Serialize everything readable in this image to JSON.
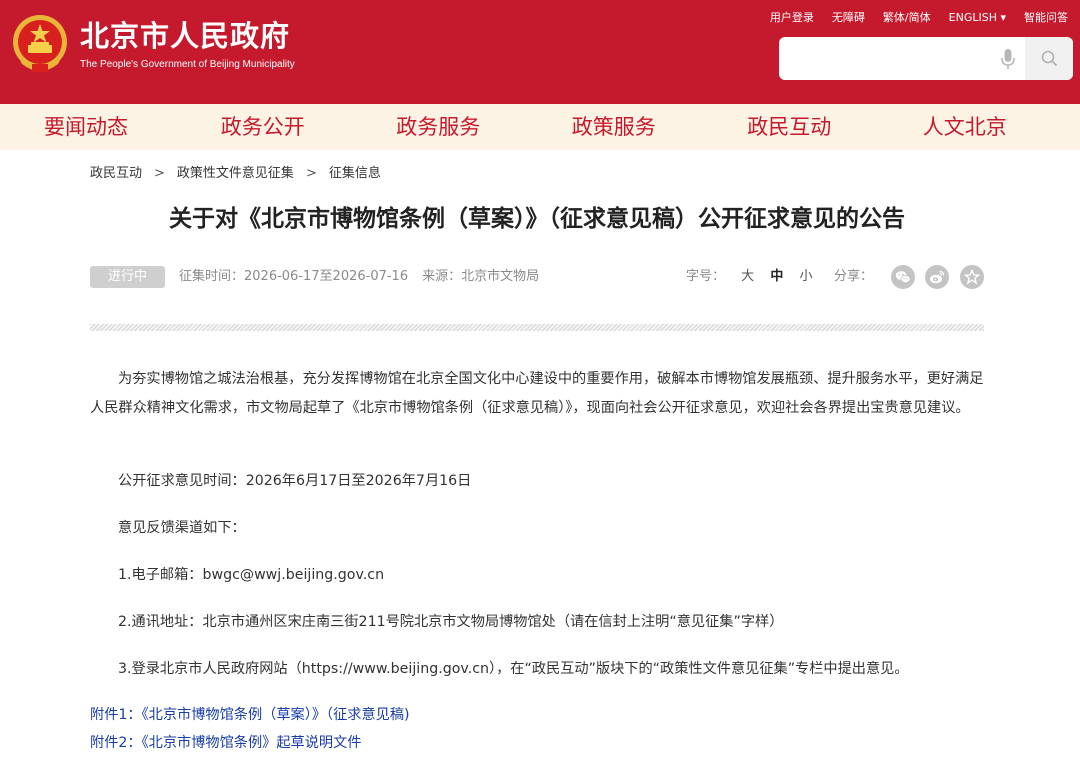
{
  "header": {
    "site_title": "北京市人民政府",
    "site_subtitle": "The People's Government of Beijing Municipality",
    "top_links": [
      "用户登录",
      "无障碍",
      "繁体/简体",
      "ENGLISH ▾",
      "智能问答"
    ],
    "search": {
      "placeholder": ""
    }
  },
  "nav": {
    "items": [
      "要闻动态",
      "政务公开",
      "政务服务",
      "政策服务",
      "政民互动",
      "人文北京"
    ]
  },
  "breadcrumb": {
    "items": [
      "政民互动",
      "政策性文件意见征集",
      "征集信息"
    ],
    "separator": ">"
  },
  "article": {
    "title": "关于对《北京市博物馆条例（草案）》（征求意见稿）公开征求意见的公告",
    "status": "进行中",
    "collect_time": "征集时间：2026-06-17至2026-07-16",
    "source": "来源：北京市文物局",
    "font_size_label": "字号：",
    "font_sizes": [
      "大",
      "中",
      "小"
    ],
    "share_label": "分享：",
    "paragraphs": [
      "为夯实博物馆之城法治根基，充分发挥博物馆在北京全国文化中心建设中的重要作用，破解本市博物馆发展瓶颈、提升服务水平，更好满足人民群众精神文化需求，市文物局起草了《北京市博物馆条例（征求意见稿）》，现面向社会公开征求意见，欢迎社会各界提出宝贵意见建议。",
      "公开征求意见时间：2026年6月17日至2026年7月16日",
      "意见反馈渠道如下：",
      "1.电子邮箱：bwgc@wwj.beijing.gov.cn",
      "2.通讯地址：北京市通州区宋庄南三街211号院北京市文物局博物馆处（请在信封上注明“意见征集”字样）",
      "3.登录北京市人民政府网站（https://www.beijing.gov.cn），在“政民互动”版块下的“政策性文件意见征集”专栏中提出意见。"
    ],
    "attachments": [
      "附件1：《北京市博物馆条例（草案）》（征求意见稿)",
      "附件2：《北京市博物馆条例》起草说明文件"
    ]
  },
  "colors": {
    "brand_red": "#c51a2d",
    "nav_bg": "#fdf3e5",
    "link_blue": "#1a3ea8",
    "badge_gray": "#cfcfcf"
  },
  "icons": [
    "national-emblem-icon",
    "microphone-icon",
    "search-icon",
    "wechat-icon",
    "weibo-icon",
    "favorite-star-icon"
  ]
}
